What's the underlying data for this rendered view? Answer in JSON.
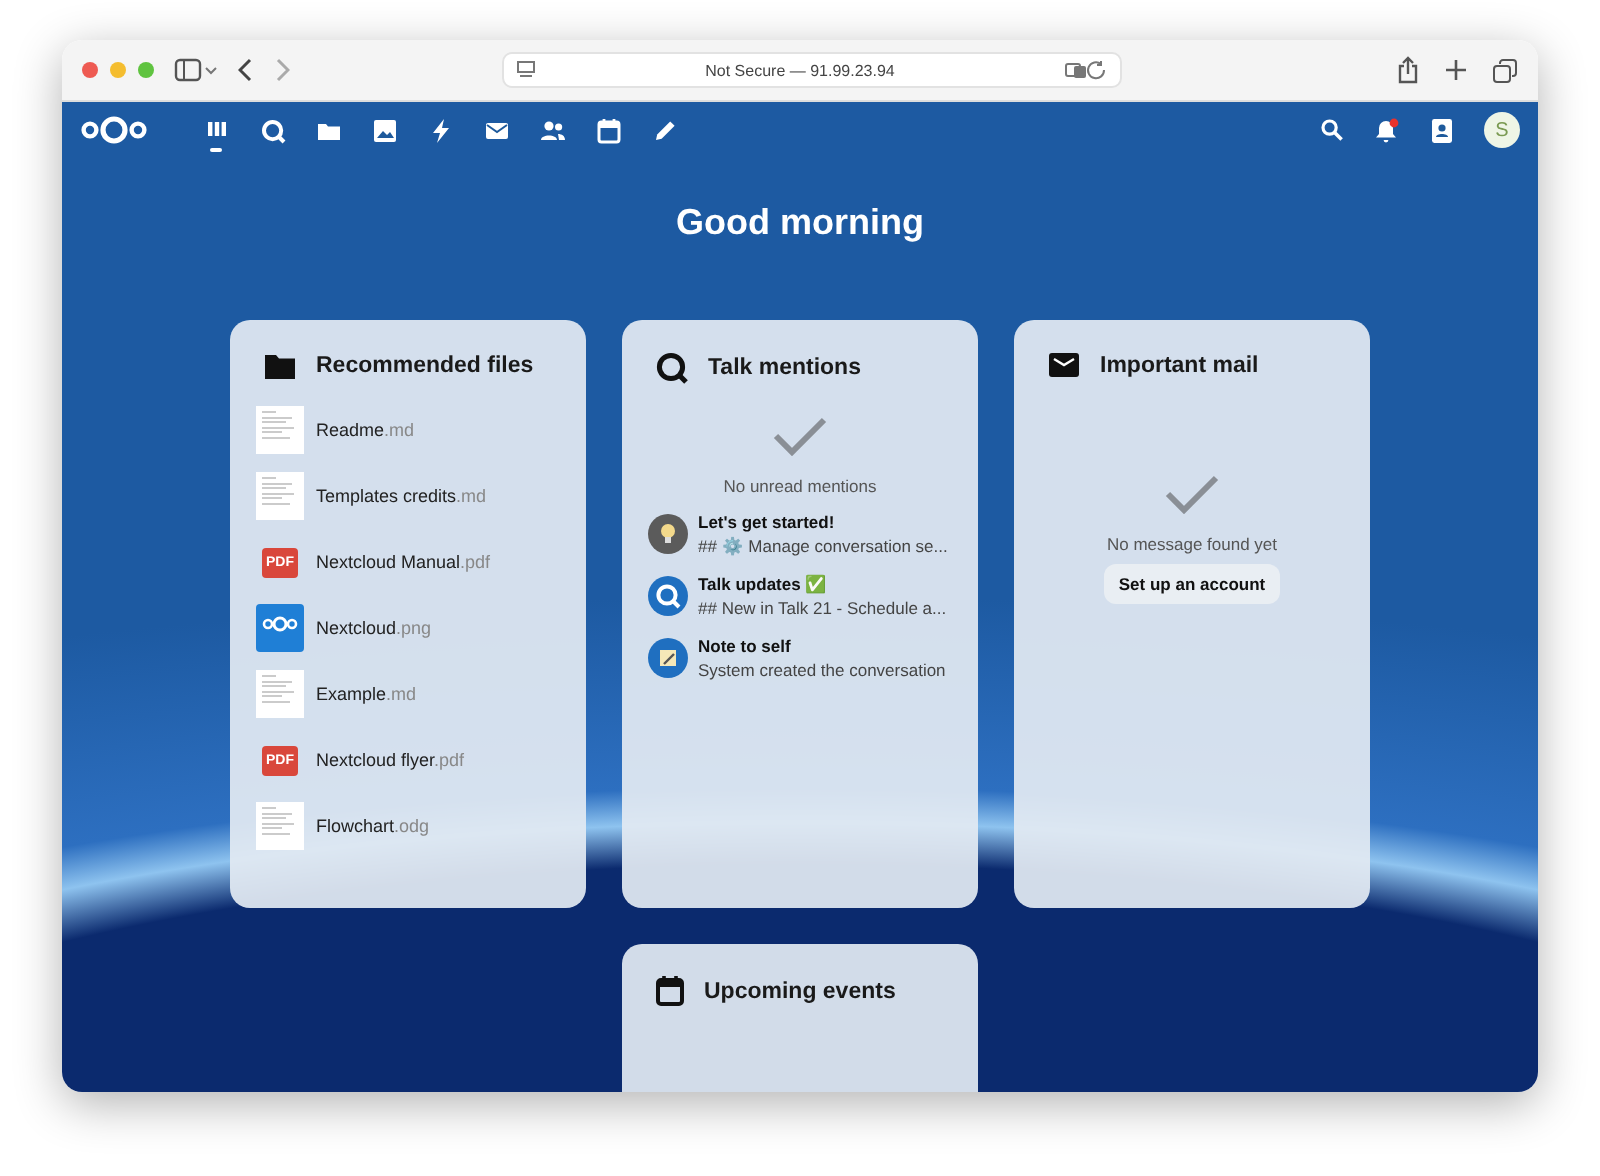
{
  "browser": {
    "address": "Not Secure — 91.99.23.94"
  },
  "nav": {
    "apps": [
      {
        "kind": "dashboard",
        "selected": true
      },
      {
        "kind": "talk",
        "selected": false
      },
      {
        "kind": "files",
        "selected": false
      },
      {
        "kind": "photos",
        "selected": false
      },
      {
        "kind": "activity",
        "selected": false
      },
      {
        "kind": "mail",
        "selected": false
      },
      {
        "kind": "contacts",
        "selected": false
      },
      {
        "kind": "calendar",
        "selected": false
      },
      {
        "kind": "notes",
        "selected": false
      }
    ],
    "notifications_unread": true,
    "avatar": "S"
  },
  "greeting": "Good morning",
  "widgets": [
    {
      "kind": "files",
      "title": "Recommended files",
      "items": [
        {
          "name": "Readme",
          "extension": ".md",
          "kind": "doc"
        },
        {
          "name": "Templates credits",
          "extension": ".md",
          "kind": "doc"
        },
        {
          "name": "Nextcloud Manual",
          "extension": ".pdf",
          "kind": "pdf",
          "thumb_label": "PDF"
        },
        {
          "name": "Nextcloud",
          "extension": ".png",
          "kind": "image"
        },
        {
          "name": "Example",
          "extension": ".md",
          "kind": "doc"
        },
        {
          "name": "Nextcloud flyer",
          "extension": ".pdf",
          "kind": "pdf",
          "thumb_label": "PDF"
        },
        {
          "name": "Flowchart",
          "extension": ".odg",
          "kind": "doc"
        }
      ]
    },
    {
      "kind": "talk",
      "title": "Talk mentions",
      "empty_text": "No unread mentions",
      "items": [
        {
          "title": "Let's get started!",
          "subtitle": "## ⚙️ Manage conversation se...",
          "kind": "bulb"
        },
        {
          "title": "Talk updates ✅",
          "subtitle": "## New in Talk 21 - Schedule a...",
          "kind": "talk"
        },
        {
          "title": "Note to self",
          "subtitle": "System created the conversation",
          "kind": "note"
        }
      ]
    },
    {
      "kind": "mail",
      "title": "Important mail",
      "empty_text": "No message found yet",
      "action": "Set up an account"
    },
    {
      "kind": "calendar",
      "title": "Upcoming events"
    }
  ]
}
